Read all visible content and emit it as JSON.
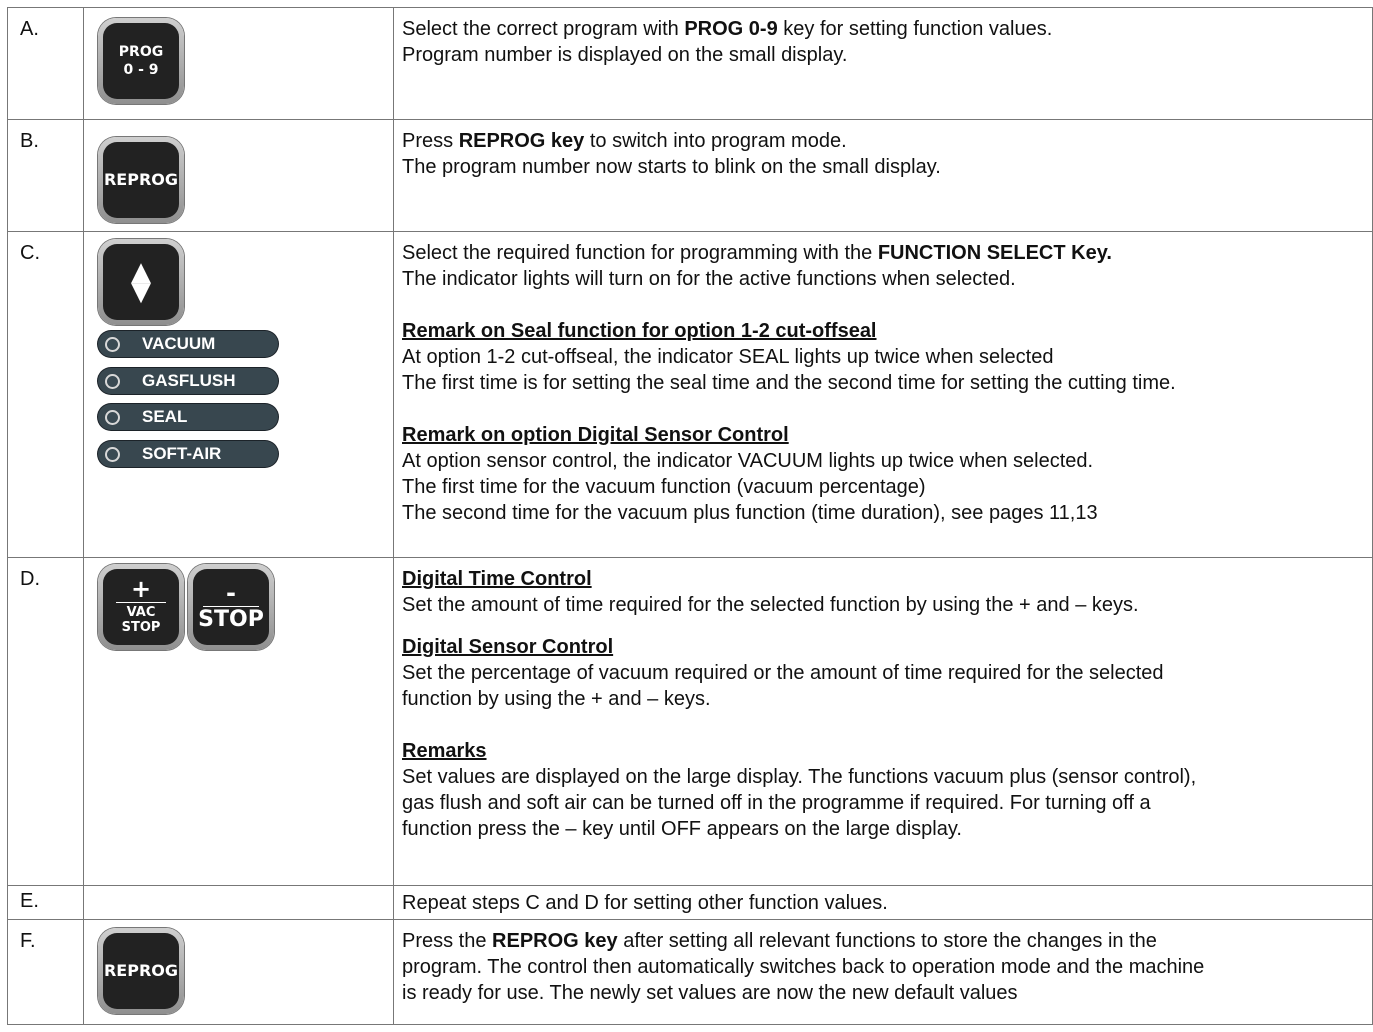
{
  "rows": [
    {
      "letter": "A.",
      "key": {
        "line1": "PROG",
        "line2": "0 - 9"
      },
      "text": {
        "l1_pre": "Select the correct program with ",
        "l1_bold": "PROG 0-9",
        "l1_post": " key for setting function values.",
        "l2": "Program number is displayed on the small display."
      }
    },
    {
      "letter": "B.",
      "key": {
        "label": "REPROG"
      },
      "text": {
        "l1_pre": "Press ",
        "l1_bold": "REPROG key",
        "l1_post": " to switch into program mode.",
        "l2": "The program number now starts to blink on the small display."
      }
    },
    {
      "letter": "C.",
      "key": {
        "up_icon": "▲",
        "down_icon": "▼"
      },
      "indicators": [
        "VACUUM",
        "GASFLUSH",
        "SEAL",
        "SOFT-AIR"
      ],
      "text": {
        "l1_pre": "Select the required function for programming with the ",
        "l1_bold": "FUNCTION SELECT Key.",
        "l2": "The indicator lights will turn on for the active functions when selected.",
        "h1": "Remark on Seal function for option 1-2 cut-offseal",
        "h1_l1": "At option 1-2 cut-offseal, the indicator SEAL lights up twice when selected",
        "h1_l2": "The first time is for setting the seal time and the second time for setting the cutting time.",
        "h2": "Remark on option Digital Sensor Control",
        "h2_l1": "At option sensor control, the indicator VACUUM lights up twice when selected.",
        "h2_l2": "The first time for the vacuum function (vacuum percentage)",
        "h2_l3": "The second time for the vacuum plus function (time duration), see pages 11,13"
      }
    },
    {
      "letter": "D.",
      "key_plus": {
        "symbol": "+",
        "line1": "VAC",
        "line2": "STOP"
      },
      "key_minus": {
        "symbol": "-",
        "label": "STOP"
      },
      "text": {
        "h1": "Digital Time Control",
        "h1_l1": "Set the amount of time required for the selected function by using the + and – keys.",
        "h2": "Digital Sensor Control",
        "h2_l1": "Set the percentage of vacuum required or the amount of time required for the selected",
        "h2_l2": "function by using the + and – keys.",
        "h3": "Remarks",
        "h3_l1": "Set values are displayed on the large display. The functions vacuum plus (sensor control),",
        "h3_l2": "gas flush and soft air can be turned off in the programme if required. For turning off a",
        "h3_l3": "function press the – key until OFF appears on the large display."
      }
    },
    {
      "letter": "E.",
      "text": {
        "l1": "Repeat steps C and D for setting other function values."
      }
    },
    {
      "letter": "F.",
      "key": {
        "label": "REPROG"
      },
      "text": {
        "l1_pre": "Press the ",
        "l1_bold": "REPROG key",
        "l1_post": " after setting all relevant functions to store the changes in the",
        "l2": "program. The control then automatically switches back to operation mode and the machine",
        "l3": "is ready for use. The newly set values are now the new default values"
      }
    }
  ]
}
